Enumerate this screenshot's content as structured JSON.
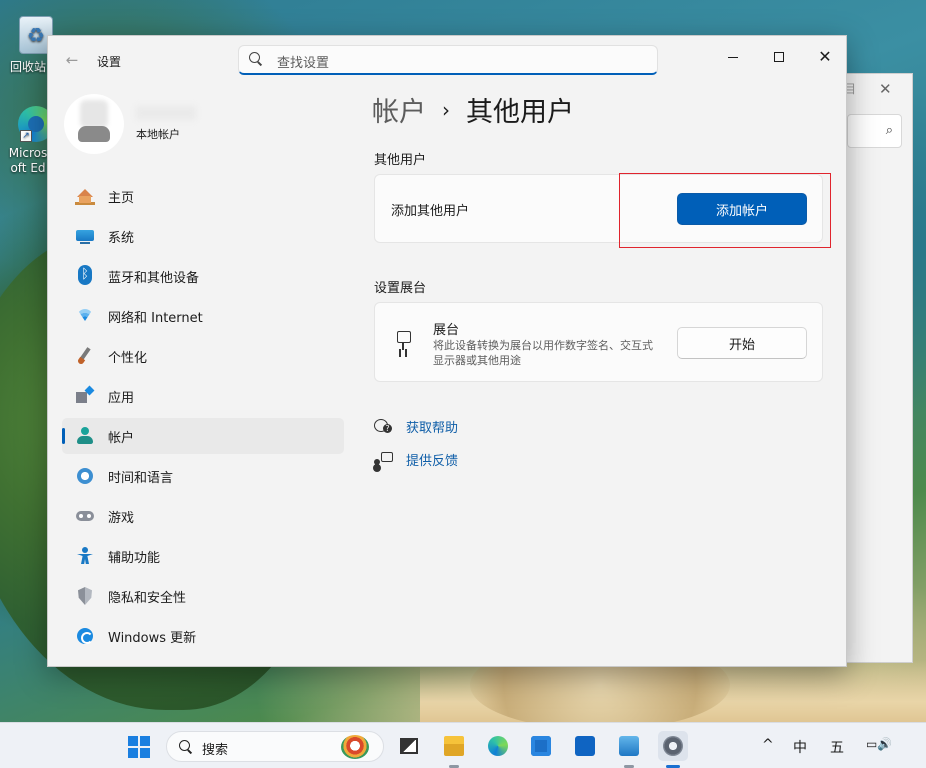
{
  "desktop": {
    "icons": [
      {
        "label": "回收站"
      },
      {
        "label": "Microsoft Edge"
      }
    ]
  },
  "settings": {
    "title": "设置",
    "search_placeholder": "查找设置",
    "profile": {
      "account_type": "本地帐户"
    },
    "nav": [
      {
        "label": "主页",
        "icon": "home-icon"
      },
      {
        "label": "系统",
        "icon": "system-icon"
      },
      {
        "label": "蓝牙和其他设备",
        "icon": "bluetooth-icon"
      },
      {
        "label": "网络和 Internet",
        "icon": "wifi-icon"
      },
      {
        "label": "个性化",
        "icon": "brush-icon"
      },
      {
        "label": "应用",
        "icon": "apps-icon"
      },
      {
        "label": "帐户",
        "icon": "accounts-icon",
        "active": true
      },
      {
        "label": "时间和语言",
        "icon": "time-language-icon"
      },
      {
        "label": "游戏",
        "icon": "gaming-icon"
      },
      {
        "label": "辅助功能",
        "icon": "accessibility-icon"
      },
      {
        "label": "隐私和安全性",
        "icon": "shield-icon"
      },
      {
        "label": "Windows 更新",
        "icon": "update-icon"
      }
    ],
    "breadcrumb": {
      "parent": "帐户",
      "separator": "›",
      "current": "其他用户"
    },
    "other_users": {
      "section_title": "其他用户",
      "label": "添加其他用户",
      "button": "添加帐户"
    },
    "kiosk": {
      "section_title": "设置展台",
      "title": "展台",
      "description": "将此设备转换为展台以用作数字签名、交互式显示器或其他用途",
      "button": "开始"
    },
    "help": {
      "get_help": "获取帮助",
      "feedback": "提供反馈"
    },
    "accent_color": "#005fb8",
    "highlight_color": "#e0242d"
  },
  "taskbar": {
    "search_label": "搜索",
    "apps": [
      "task-view-icon",
      "file-explorer-icon",
      "edge-icon",
      "store-icon",
      "outlook-icon",
      "remote-desktop-icon",
      "settings-icon"
    ],
    "tray": {
      "chevron": "^",
      "ime_mode": "中",
      "ime_name": "五",
      "status_icons": "▭🔊"
    }
  }
}
